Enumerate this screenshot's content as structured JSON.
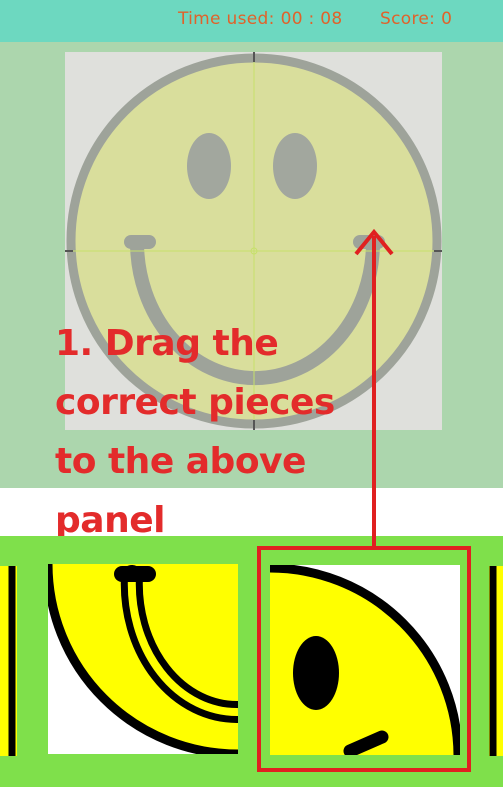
{
  "header": {
    "time_label": "Time used:",
    "time_value": "00 : 08",
    "score_label": "Score:",
    "score_value": "0"
  },
  "instruction": {
    "line1": "1. Drag the",
    "line2": "correct pieces",
    "line3": "to the above",
    "line4": "panel"
  },
  "colors": {
    "topbar": "#6dd8c0",
    "board": "#acd6ad",
    "tray": "#7fe04b",
    "stat_text": "#e0622a",
    "instruction_text": "#e32b2b",
    "smiley_fill": "#ffff00",
    "smiley_outline": "#000000"
  },
  "board": {
    "image": "smiley-face-icon",
    "grid": "2x2",
    "pieces_placed": 0
  },
  "tray": {
    "pieces": [
      {
        "name": "piece-partial-left"
      },
      {
        "name": "piece-smile-left"
      },
      {
        "name": "piece-eye-right"
      },
      {
        "name": "piece-partial-right"
      }
    ]
  }
}
